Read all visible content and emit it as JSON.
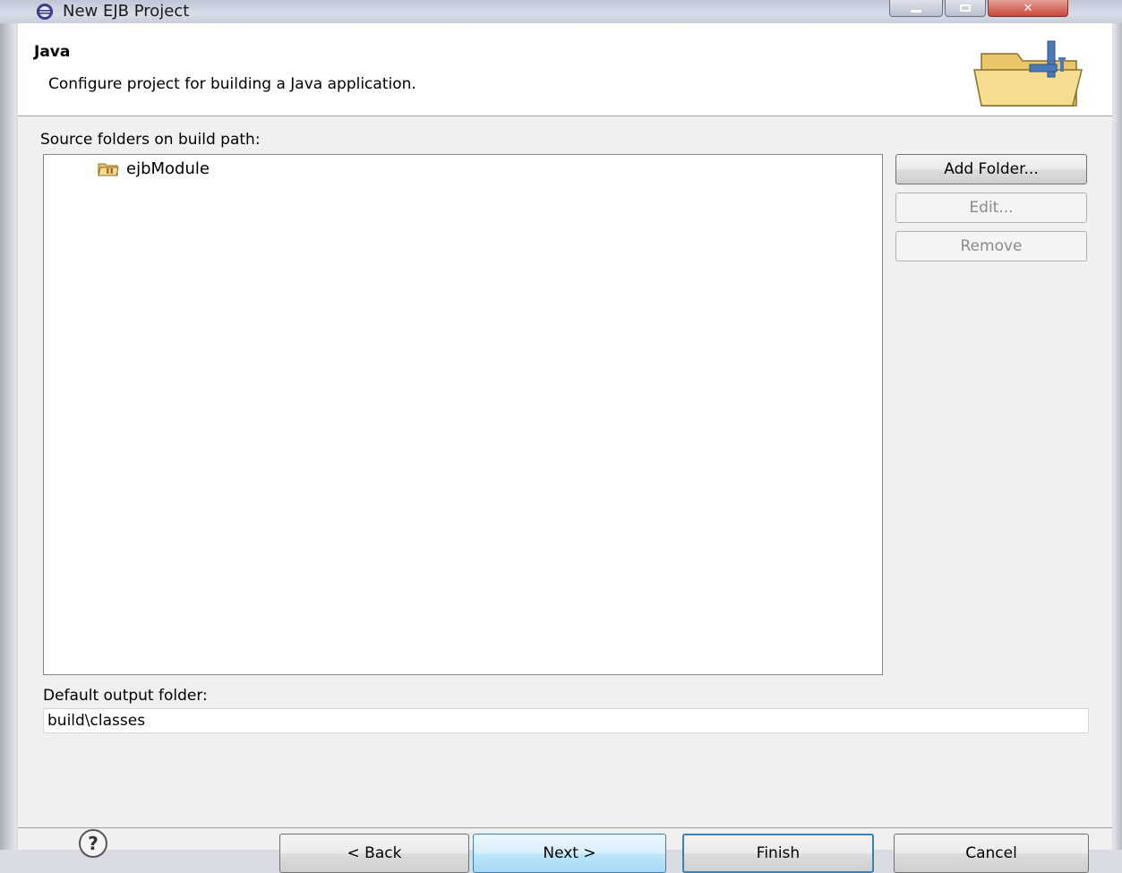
{
  "window": {
    "title": "New EJB Project",
    "controls": [
      "minimize",
      "maximize",
      "close"
    ]
  },
  "banner": {
    "title": "Java",
    "description": "Configure project for building a Java application.",
    "graphic_icon": "java-folder-wizard-icon"
  },
  "source_folders": {
    "label": "Source folders on build path:",
    "items": [
      {
        "label": "ejbModule",
        "icon": "package-folder-icon"
      }
    ]
  },
  "side_buttons": {
    "add_folder": "Add Folder...",
    "edit": "Edit...",
    "remove": "Remove"
  },
  "output": {
    "label": "Default output folder:",
    "value": "build\\classes"
  },
  "footer": {
    "help_icon": "help-icon",
    "back": "< Back",
    "next": "Next >",
    "finish": "Finish",
    "cancel": "Cancel"
  },
  "colors": {
    "dialog_bg": "#f0f0f0",
    "banner_bg": "#ffffff",
    "focus_blue": "#3c7fb1"
  }
}
